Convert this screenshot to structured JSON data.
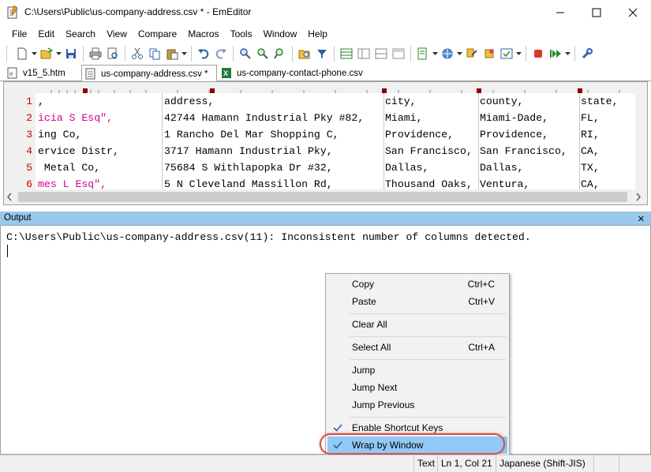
{
  "window": {
    "title": "C:\\Users\\Public\\us-company-address.csv * - EmEditor"
  },
  "menu": [
    "File",
    "Edit",
    "Search",
    "View",
    "Compare",
    "Macros",
    "Tools",
    "Window",
    "Help"
  ],
  "tabs": [
    {
      "label": "v15_5.htm",
      "active": false
    },
    {
      "label": "us-company-address.csv *",
      "active": true
    },
    {
      "label": "us-company-contact-phone.csv",
      "active": false
    }
  ],
  "editor": {
    "line_numbers": [
      "1",
      "2",
      "3",
      "4",
      "5",
      "6"
    ],
    "rows": [
      [
        ",",
        "address,",
        "city,",
        "county,",
        "state,"
      ],
      [
        "icia S Esq\",",
        "42744 Hamann Industrial Pky #82,",
        "Miami,",
        "Miami-Dade,",
        "FL,"
      ],
      [
        "ing Co,",
        "1 Rancho Del Mar Shopping C,",
        "Providence,",
        "Providence,",
        "RI,"
      ],
      [
        "ervice Distr,",
        "3717 Hamann Industrial Pky,",
        "San Francisco,",
        "San Francisco,",
        "CA,"
      ],
      [
        " Metal Co,",
        "75684 S Withlapopka Dr #32,",
        "Dallas,",
        "Dallas,",
        "TX,"
      ],
      [
        "mes L Esq\",",
        "5 N Cleveland Massillon Rd,",
        "Thousand Oaks,",
        "Ventura,",
        "CA,"
      ]
    ],
    "magenta_rows": [
      1,
      5
    ]
  },
  "output": {
    "title": "Output",
    "message": "C:\\Users\\Public\\us-company-address.csv(11): Inconsistent number of columns detected."
  },
  "context_menu": {
    "items": [
      {
        "label": "Copy",
        "shortcut": "Ctrl+C",
        "checked": false
      },
      {
        "label": "Paste",
        "shortcut": "Ctrl+V",
        "checked": false
      },
      {
        "label": "Clear All",
        "shortcut": "",
        "checked": false
      },
      {
        "label": "Select All",
        "shortcut": "Ctrl+A",
        "checked": false
      },
      {
        "label": "Jump",
        "shortcut": "",
        "checked": false
      },
      {
        "label": "Jump Next",
        "shortcut": "",
        "checked": false
      },
      {
        "label": "Jump Previous",
        "shortcut": "",
        "checked": false
      },
      {
        "label": "Enable Shortcut Keys",
        "shortcut": "",
        "checked": true
      },
      {
        "label": "Wrap by Window",
        "shortcut": "",
        "checked": true,
        "highlighted": true
      }
    ]
  },
  "status": {
    "mode": "Text",
    "position": "Ln 1, Col 21",
    "encoding": "Japanese (Shift-JIS)"
  },
  "colors": {
    "line_number": "#cc0000",
    "magenta_text": "#d4008f",
    "output_title_bg": "#99c8ea",
    "highlight": "#91c9f7",
    "ring": "#d84e45"
  }
}
